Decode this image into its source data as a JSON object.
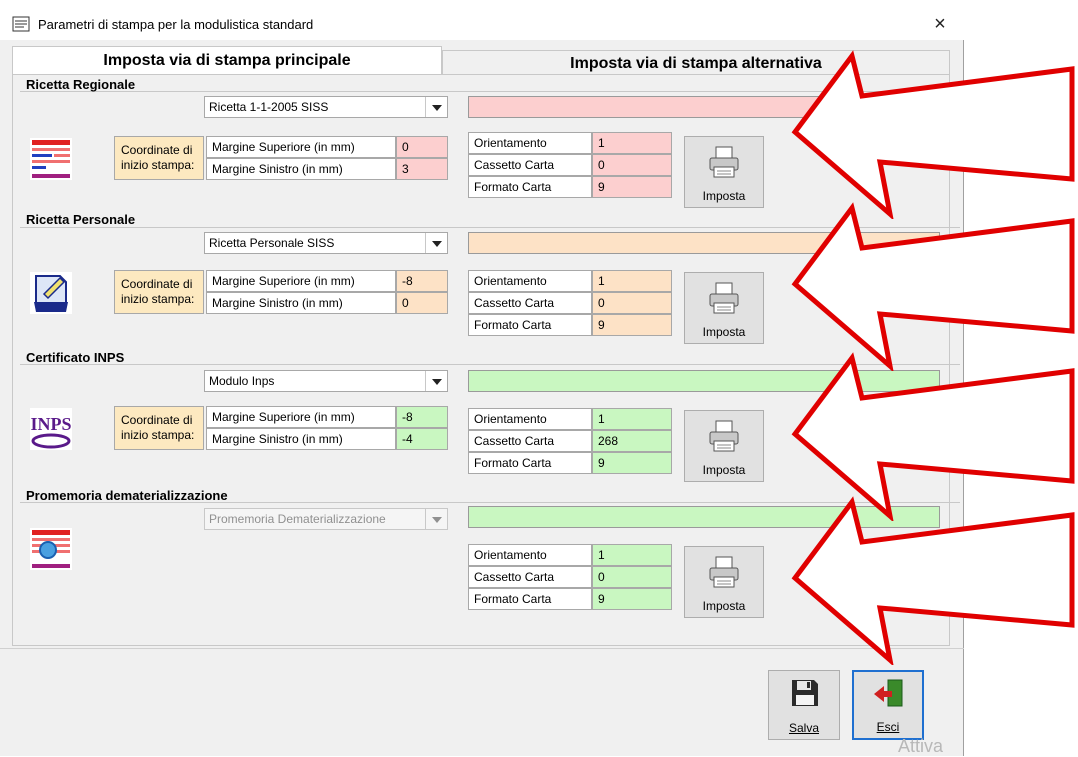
{
  "window": {
    "title": "Parametri di stampa per la modulistica standard",
    "close_label": "×"
  },
  "tabs": [
    {
      "label": "Imposta via di stampa principale"
    },
    {
      "label": "Imposta via di stampa alternativa"
    }
  ],
  "labels": {
    "coord": "Coordinate di inizio stampa:",
    "margine_superiore": "Margine Superiore (in mm)",
    "margine_sinistro": "Margine Sinistro (in mm)",
    "orientamento": "Orientamento",
    "cassetto": "Cassetto Carta",
    "formato": "Formato Carta",
    "imposta": "Imposta"
  },
  "sections": [
    {
      "title": "Ricetta Regionale",
      "combo": "Ricetta 1-1-2005 SISS",
      "color": "#fccfcf",
      "margine_superiore": "0",
      "margine_sinistro": "3",
      "orientamento": "1",
      "cassetto": "0",
      "formato": "9"
    },
    {
      "title": "Ricetta Personale",
      "combo": "Ricetta Personale SISS",
      "color": "#fde2c6",
      "margine_superiore": "-8",
      "margine_sinistro": "0",
      "orientamento": "1",
      "cassetto": "0",
      "formato": "9"
    },
    {
      "title": "Certificato INPS",
      "combo": "Modulo Inps",
      "color": "#c9f7c1",
      "margine_superiore": "-8",
      "margine_sinistro": "-4",
      "orientamento": "1",
      "cassetto": "268",
      "formato": "9"
    },
    {
      "title": "Promemoria dematerializzazione",
      "combo": "Promemoria Dematerializzazione",
      "color": "#c9f7c1",
      "orientamento": "1",
      "cassetto": "0",
      "formato": "9"
    }
  ],
  "buttons": {
    "salva": "Salva",
    "esci": "Esci"
  },
  "watermark": "Attiva",
  "colors": {
    "arrow_red": "#e00000"
  }
}
